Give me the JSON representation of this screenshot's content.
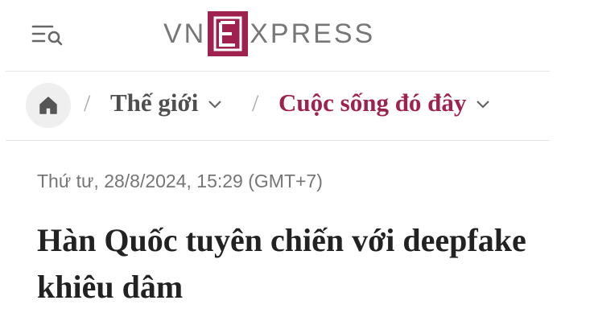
{
  "header": {
    "menu_icon": "menu-search-icon",
    "logo": {
      "left": "VN",
      "middle": "E",
      "right": "XPRESS",
      "brand_color": "#9f224e"
    }
  },
  "breadcrumb": {
    "home_icon": "home-icon",
    "separator": "/",
    "items": [
      {
        "label": "Thế giới",
        "color": "#4f4f4f"
      },
      {
        "label": "Cuộc sống đó đây",
        "color": "#9f224e"
      }
    ]
  },
  "article": {
    "date": "Thứ tư, 28/8/2024, 15:29 (GMT+7)",
    "title": "Hàn Quốc tuyên chiến với deepfake khiêu dâm"
  }
}
